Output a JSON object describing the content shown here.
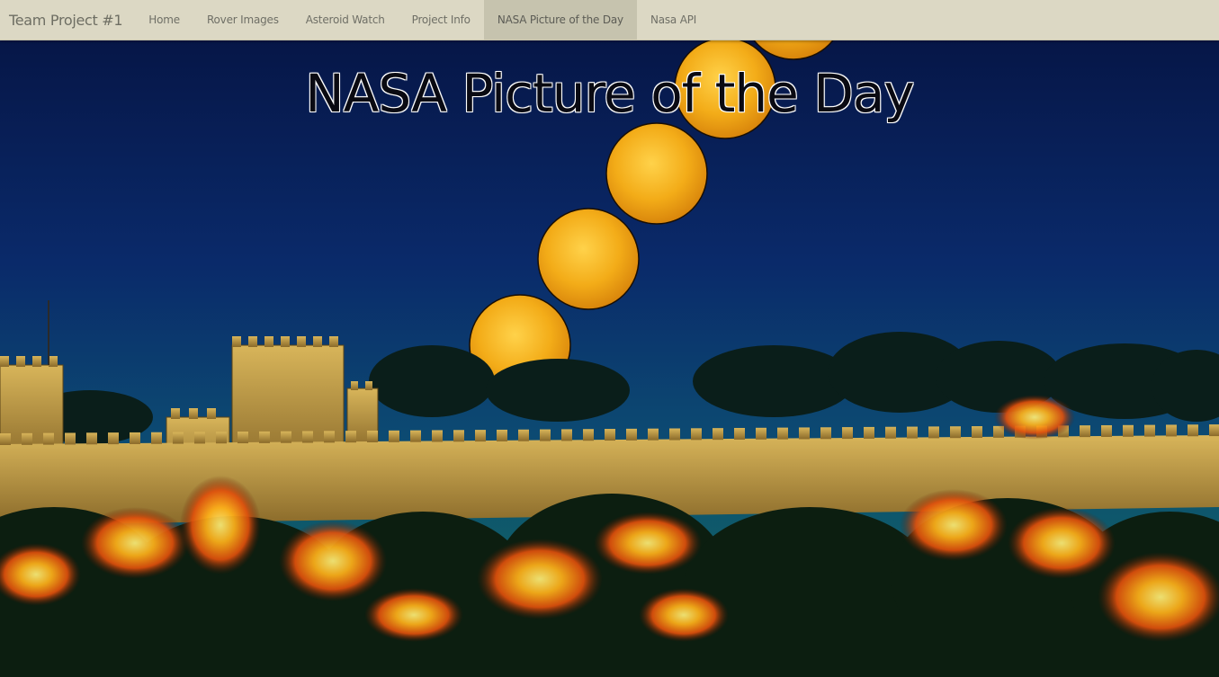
{
  "navbar": {
    "brand": "Team Project #1",
    "items": [
      {
        "label": "Home",
        "active": false
      },
      {
        "label": "Rover Images",
        "active": false
      },
      {
        "label": "Asteroid Watch",
        "active": false
      },
      {
        "label": "Project Info",
        "active": false
      },
      {
        "label": "NASA Picture of the Day",
        "active": true
      },
      {
        "label": "Nasa API",
        "active": false
      }
    ],
    "background": "#dcd8c4",
    "active_background": "#c6c3ae"
  },
  "main": {
    "title": "NASA Picture of the Day"
  },
  "colors": {
    "sky_top": "#071a4a",
    "sky_bottom": "#0d4a6a",
    "moon": "#f5b21a",
    "wall": "#c8a24a",
    "fire": "#ff7a10"
  }
}
